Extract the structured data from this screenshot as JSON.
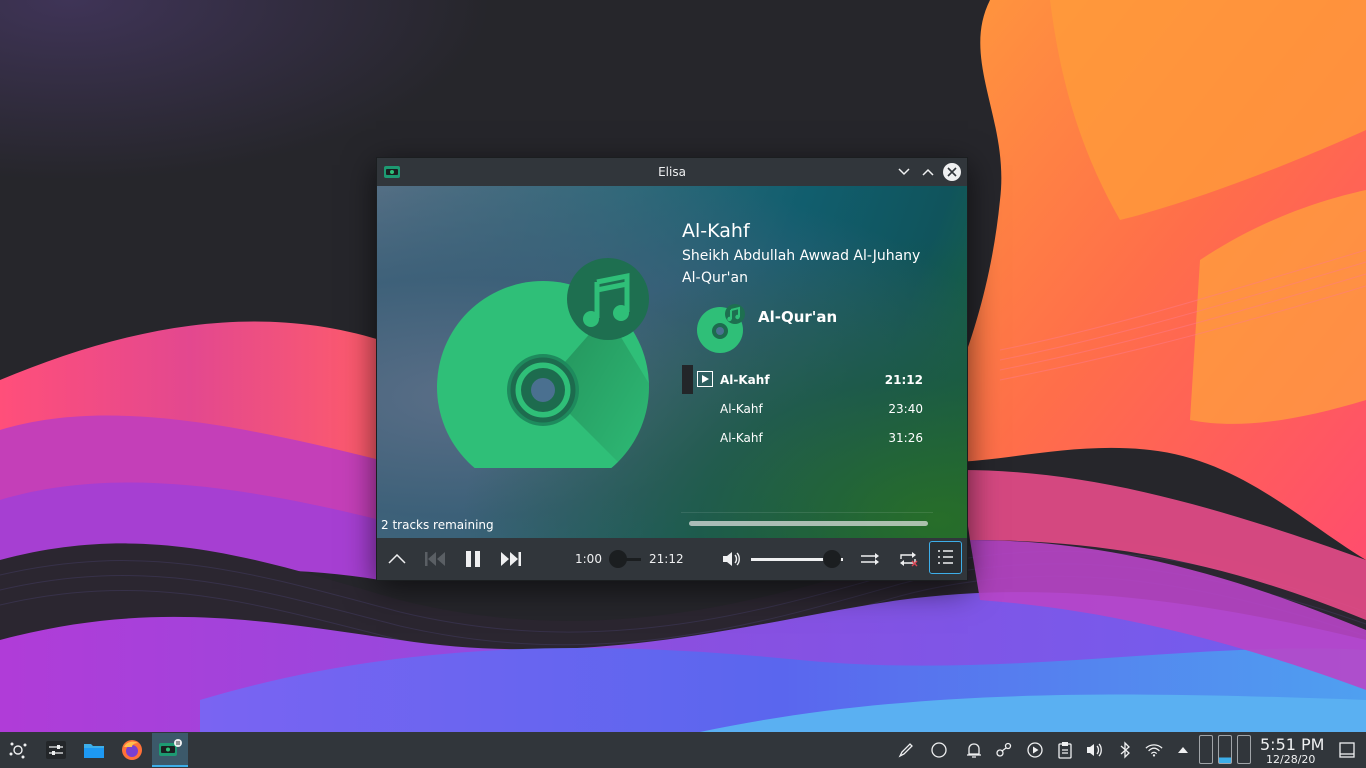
{
  "window": {
    "title": "Elisa"
  },
  "now_playing": {
    "title": "Al-Kahf",
    "artist": "Sheikh Abdullah Awwad Al-Juhany",
    "album": "Al-Qur'an"
  },
  "playlist": {
    "album_header": "Al-Qur'an",
    "tracks": [
      {
        "name": "Al-Kahf",
        "duration": "21:12",
        "current": true
      },
      {
        "name": "Al-Kahf",
        "duration": "23:40",
        "current": false
      },
      {
        "name": "Al-Kahf",
        "duration": "31:26",
        "current": false
      }
    ],
    "remaining": "2 tracks remaining"
  },
  "controls": {
    "elapsed": "1:00",
    "total": "21:12",
    "volume_fraction": 0.88
  },
  "taskbar": {
    "clock_time": "5:51 PM",
    "clock_date": "12/28/20"
  },
  "colors": {
    "accent": "#3daee9",
    "cover_green": "#2fbf78",
    "cover_dark": "#1d6b4e"
  }
}
